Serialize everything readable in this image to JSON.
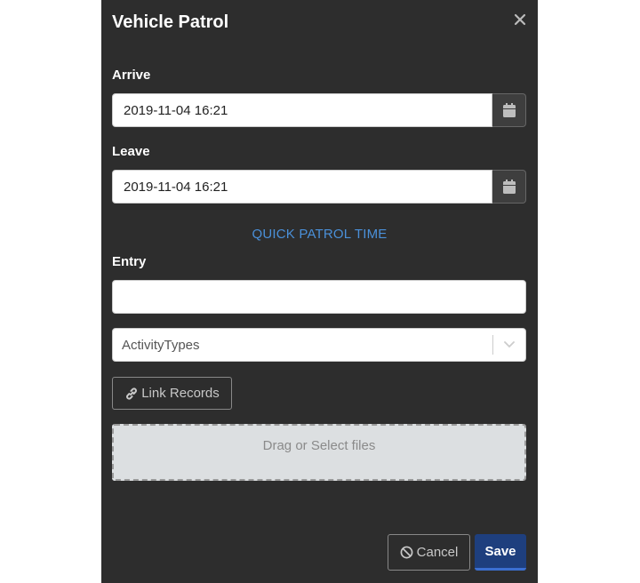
{
  "modal": {
    "title": "Vehicle Patrol"
  },
  "arrive": {
    "label": "Arrive",
    "value": "2019-11-04 16:21"
  },
  "leave": {
    "label": "Leave",
    "value": "2019-11-04 16:21"
  },
  "quick_patrol": {
    "label": "QUICK PATROL TIME"
  },
  "entry": {
    "label": "Entry",
    "value": ""
  },
  "activity_types": {
    "placeholder": "ActivityTypes"
  },
  "link_records": {
    "label": "Link Records"
  },
  "dropzone": {
    "label": "Drag or Select files"
  },
  "footer": {
    "cancel_label": "Cancel",
    "save_label": "Save"
  },
  "icons": {
    "close": "close-icon",
    "calendar": "calendar-icon",
    "chevron": "chevron-down-icon",
    "link": "link-icon",
    "ban": "ban-icon"
  },
  "colors": {
    "modal_bg": "#2d2d2d",
    "accent_link": "#4a90d9",
    "save_bg": "#1e3f7e"
  }
}
